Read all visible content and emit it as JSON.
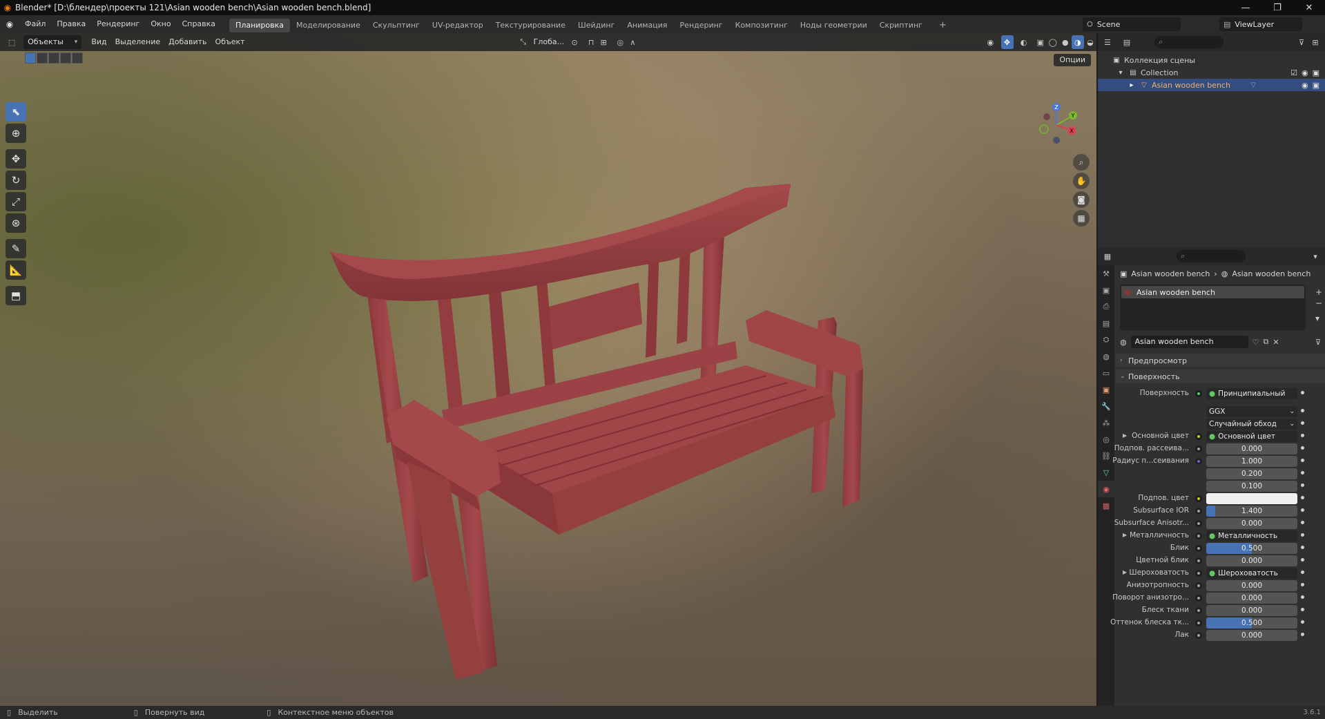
{
  "window": {
    "title": "Blender* [D:\\блендер\\проекты 121\\Asian wooden bench\\Asian wooden bench.blend]"
  },
  "menus": [
    "Файл",
    "Правка",
    "Рендеринг",
    "Окно",
    "Справка"
  ],
  "workspaces": [
    {
      "label": "Планировка",
      "active": true
    },
    {
      "label": "Моделирование"
    },
    {
      "label": "Скульптинг"
    },
    {
      "label": "UV-редактор"
    },
    {
      "label": "Текстурирование"
    },
    {
      "label": "Шейдинг"
    },
    {
      "label": "Анимация"
    },
    {
      "label": "Рендеринг"
    },
    {
      "label": "Композитинг"
    },
    {
      "label": "Ноды геометрии"
    },
    {
      "label": "Скриптинг"
    }
  ],
  "scene": "Scene",
  "view_layer": "ViewLayer",
  "viewport_header": {
    "mode": "Объекты",
    "menus": [
      "Вид",
      "Выделение",
      "Добавить",
      "Объект"
    ],
    "transform": "Глоба...",
    "options": "Опции"
  },
  "gizmo": {
    "z": "Z",
    "y": "Y",
    "x": "X"
  },
  "outliner": {
    "root": "Коллекция сцены",
    "collection": "Collection",
    "object": "Asian wooden bench"
  },
  "properties": {
    "breadcrumb_object": "Asian wooden bench",
    "breadcrumb_material": "Asian wooden bench",
    "slot": "Asian wooden bench",
    "material_name": "Asian wooden bench",
    "panel_preview": "Предпросмотр",
    "panel_surface": "Поверхность",
    "rows": [
      {
        "label": "Поверхность",
        "type": "link",
        "value": "Принципиальный BSDF",
        "dot": "#63c763"
      },
      {
        "label": "",
        "type": "drop",
        "value": "GGX"
      },
      {
        "label": "",
        "type": "drop",
        "value": "Случайный обход"
      },
      {
        "label": "Основной цвет",
        "type": "link",
        "value": "Основной цвет",
        "dot": "#c7c729",
        "tri": true
      },
      {
        "label": "Подпов. рассеива...",
        "type": "num",
        "value": "0.000",
        "dot": "#a1a1a1"
      },
      {
        "label": "Радиус п...сеивания",
        "type": "num",
        "value": "1.000",
        "dot": "#6363c7"
      },
      {
        "label": "",
        "type": "num",
        "value": "0.200"
      },
      {
        "label": "",
        "type": "num",
        "value": "0.100"
      },
      {
        "label": "Подпов. цвет",
        "type": "color",
        "value": "",
        "dot": "#c7c729"
      },
      {
        "label": "Subsurface IOR",
        "type": "num",
        "value": "1.400",
        "dot": "#a1a1a1",
        "fill": 0.1
      },
      {
        "label": "Subsurface Anisotr...",
        "type": "num",
        "value": "0.000",
        "dot": "#a1a1a1"
      },
      {
        "label": "Металличность",
        "type": "link",
        "value": "Металличность",
        "dot": "#a1a1a1",
        "tri": true
      },
      {
        "label": "Блик",
        "type": "num",
        "value": "0.500",
        "dot": "#a1a1a1",
        "fill": 0.5
      },
      {
        "label": "Цветной блик",
        "type": "num",
        "value": "0.000",
        "dot": "#a1a1a1"
      },
      {
        "label": "Шероховатость",
        "type": "link",
        "value": "Шероховатость",
        "dot": "#a1a1a1",
        "tri": true
      },
      {
        "label": "Анизотропность",
        "type": "num",
        "value": "0.000",
        "dot": "#a1a1a1"
      },
      {
        "label": "Поворот анизотро...",
        "type": "num",
        "value": "0.000",
        "dot": "#a1a1a1"
      },
      {
        "label": "Блеск ткани",
        "type": "num",
        "value": "0.000",
        "dot": "#a1a1a1"
      },
      {
        "label": "Оттенок блеска тк...",
        "type": "num",
        "value": "0.500",
        "dot": "#a1a1a1",
        "fill": 0.5
      },
      {
        "label": "Лак",
        "type": "num",
        "value": "0.000",
        "dot": "#a1a1a1"
      }
    ]
  },
  "status": {
    "select": "Выделить",
    "rotate": "Повернуть вид",
    "context": "Контекстное меню объектов",
    "version": "3.6.1"
  },
  "colors": {
    "accent": "#4772b3",
    "selection": "#334d80",
    "wood": "#8a3a3c"
  }
}
